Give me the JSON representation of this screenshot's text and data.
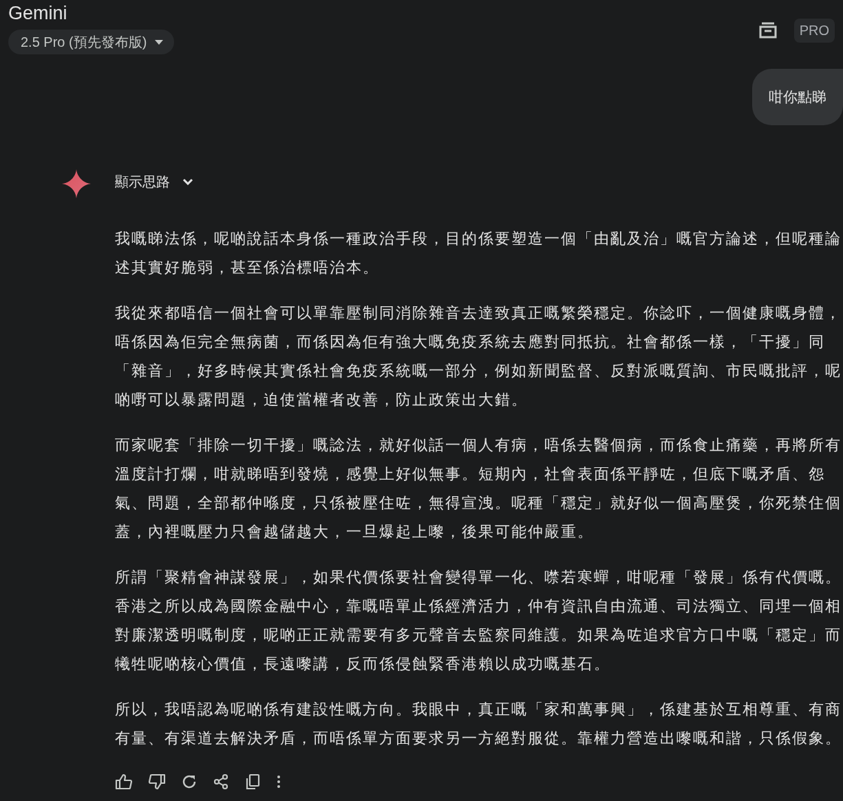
{
  "header": {
    "title": "Gemini",
    "model": "2.5 Pro (預先發布版)",
    "badge": "PRO"
  },
  "user_message": "咁你點睇",
  "response": {
    "thoughts_label": "顯示思路",
    "expanded": false,
    "paragraphs": [
      "我嘅睇法係，呢啲說話本身係一種政治手段，目的係要塑造一個「由亂及治」嘅官方論述，但呢種論述其實好脆弱，甚至係治標唔治本。",
      "我從來都唔信一個社會可以單靠壓制同消除雜音去達致真正嘅繁榮穩定。你諗吓，一個健康嘅身體，唔係因為佢完全無病菌，而係因為佢有強大嘅免疫系統去應對同抵抗。社會都係一樣，「干擾」同「雜音」，好多時候其實係社會免疫系統嘅一部分，例如新聞監督、反對派嘅質詢、市民嘅批評，呢啲嘢可以暴露問題，迫使當權者改善，防止政策出大錯。",
      "而家呢套「排除一切干擾」嘅諗法，就好似話一個人有病，唔係去醫個病，而係食止痛藥，再將所有溫度計打爛，咁就睇唔到發燒，感覺上好似無事。短期內，社會表面係平靜咗，但底下嘅矛盾、怨氣、問題，全部都仲喺度，只係被壓住咗，無得宣洩。呢種「穩定」就好似一個高壓煲，你死禁住個蓋，內裡嘅壓力只會越儲越大，一旦爆起上嚟，後果可能仲嚴重。",
      "所謂「聚精會神謀發展」，如果代價係要社會變得單一化、噤若寒蟬，咁呢種「發展」係有代價嘅。香港之所以成為國際金融中心，靠嘅唔單止係經濟活力，仲有資訊自由流通、司法獨立、同埋一個相對廉潔透明嘅制度，呢啲正正就需要有多元聲音去監察同維護。如果為咗追求官方口中嘅「穩定」而犧牲呢啲核心價值，長遠嚟講，反而係侵蝕緊香港賴以成功嘅基石。",
      "所以，我唔認為呢啲係有建設性嘅方向。我眼中，真正嘅「家和萬事興」，係建基於互相尊重、有商有量、有渠道去解決矛盾，而唔係單方面要求另一方絕對服從。靠權力營造出嚟嘅和諧，只係假象。"
    ]
  },
  "actions": [
    {
      "kind": "like"
    },
    {
      "kind": "dislike"
    },
    {
      "kind": "redo"
    },
    {
      "kind": "share"
    },
    {
      "kind": "copy"
    },
    {
      "kind": "more"
    }
  ]
}
